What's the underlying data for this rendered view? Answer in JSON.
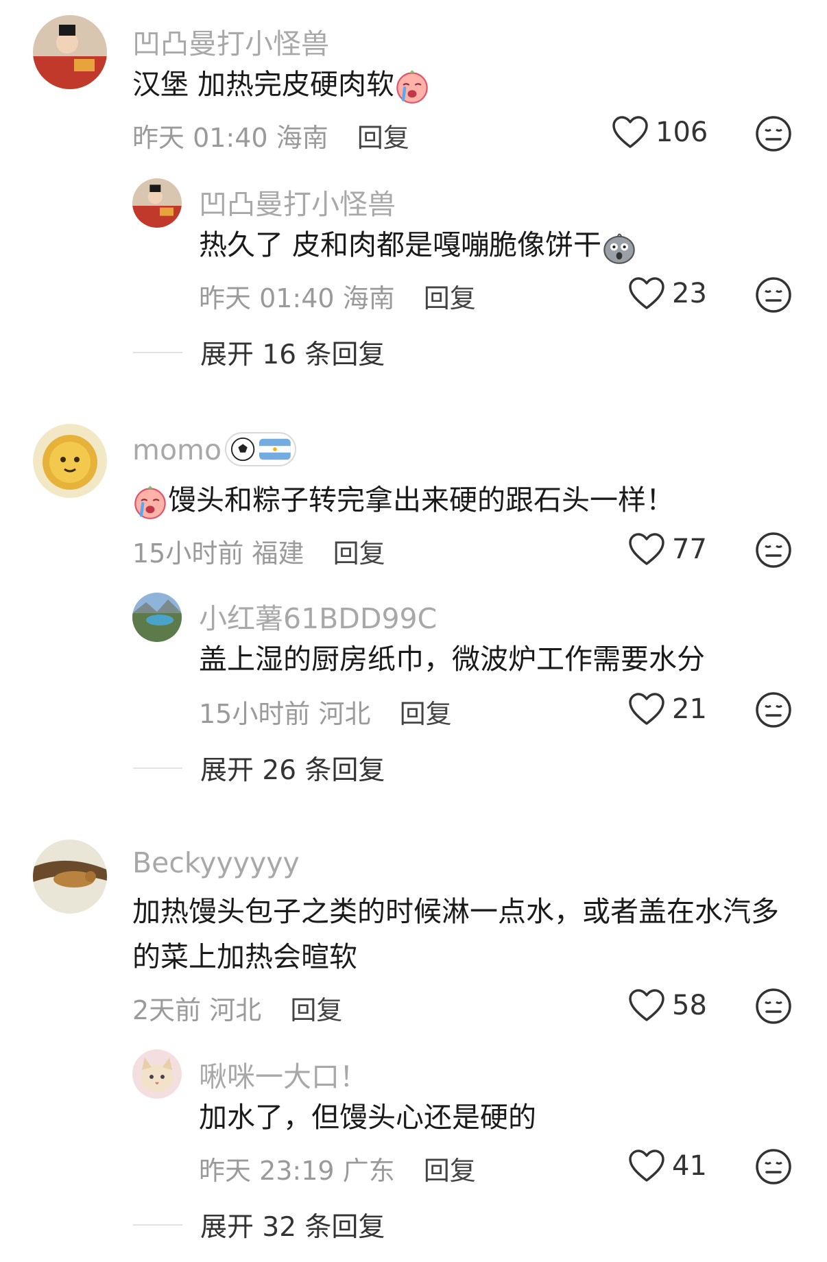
{
  "comments": [
    {
      "username": "凹凸曼打小怪兽",
      "text": "汉堡 加热完皮硬肉软",
      "time": "昨天 01:40",
      "location": "海南",
      "reply_label": "回复",
      "likes": "106",
      "reply": {
        "username": "凹凸曼打小怪兽",
        "text": "热久了 皮和肉都是嘎嘣脆像饼干",
        "time": "昨天 01:40",
        "location": "海南",
        "reply_label": "回复",
        "likes": "23"
      },
      "expand": "展开 16 条回复"
    },
    {
      "username": "momo",
      "text": "馒头和粽子转完拿出来硬的跟石头一样！",
      "time": "15小时前",
      "location": "福建",
      "reply_label": "回复",
      "likes": "77",
      "reply": {
        "username": "小红薯61BDD99C",
        "text": "盖上湿的厨房纸巾，微波炉工作需要水分",
        "time": "15小时前",
        "location": "河北",
        "reply_label": "回复",
        "likes": "21"
      },
      "expand": "展开 26 条回复"
    },
    {
      "username": "Beckyyyyyy",
      "text_line1": "加热馒头包子之类的时候淋一点水，或者盖在水汽多",
      "text_line2": "的菜上加热会暄软",
      "time": "2天前",
      "location": "河北",
      "reply_label": "回复",
      "likes": "58",
      "reply": {
        "username": "啾咪一大口！",
        "text": "加水了，但馒头心还是硬的",
        "time": "昨天 23:19",
        "location": "广东",
        "reply_label": "回复",
        "likes": "41"
      },
      "expand": "展开 32 条回复"
    }
  ],
  "icons": {
    "like": "heart-outline-icon",
    "dislike": "neutral-face-icon",
    "emoji_crying": "crying-face-emoji",
    "emoji_shocked": "shocked-rock-emoji",
    "badge_ball": "soccer-ball-icon",
    "badge_flag": "argentina-flag-icon"
  },
  "colors": {
    "username": "#a8a8a8",
    "text": "#1a1a1a",
    "meta": "#9a9a9a"
  }
}
